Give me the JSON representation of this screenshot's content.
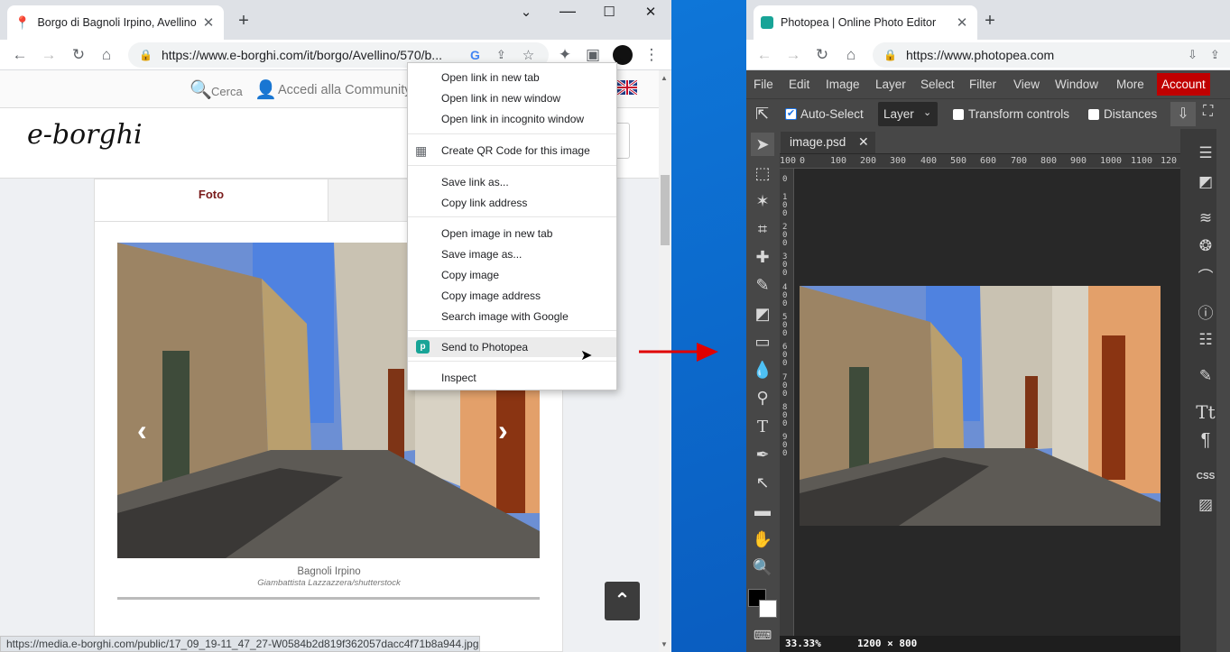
{
  "left_browser": {
    "tab_title": "Borgo di Bagnoli Irpino, Avellino",
    "url": "https://www.e-borghi.com/it/borgo/Avellino/570/b...",
    "window_controls": {
      "minimize": "—",
      "maximize": "☐",
      "close": "✕",
      "dropdown": "⌄"
    },
    "site": {
      "search_label": "Cerca",
      "community_label": "Accedi alla Community",
      "logo": "e-borghi",
      "tab_foto": "Foto",
      "caption_title": "Bagnoli Irpino",
      "caption_credit": "Giambattista Lazzazzera/shutterstock"
    },
    "status_url": "https://media.e-borghi.com/public/17_09_19-11_47_27-W0584b2d819f362057dacc4f71b8a944.jpg"
  },
  "context_menu": {
    "items": [
      "Open link in new tab",
      "Open link in new window",
      "Open link in incognito window",
      "Create QR Code for this image",
      "Save link as...",
      "Copy link address",
      "Open image in new tab",
      "Save image as...",
      "Copy image",
      "Copy image address",
      "Search image with Google",
      "Send to Photopea",
      "Inspect"
    ]
  },
  "right_browser": {
    "tab_title": "Photopea | Online Photo Editor",
    "url": "https://www.photopea.com",
    "menu": [
      "File",
      "Edit",
      "Image",
      "Layer",
      "Select",
      "Filter",
      "View",
      "Window",
      "More"
    ],
    "account_label": "Account",
    "options": {
      "auto_select": "Auto-Select",
      "layer_select": "Layer",
      "transform_controls": "Transform controls",
      "distances": "Distances"
    },
    "doc_tab": "image.psd",
    "ruler_ticks": [
      "100",
      "0",
      "100",
      "200",
      "300",
      "400",
      "500",
      "600",
      "700",
      "800",
      "900",
      "1000",
      "1100",
      "120"
    ],
    "vruler_labels": [
      "0",
      "1 0 0",
      "2 0 0",
      "3 0 0",
      "4 0 0",
      "5 0 0",
      "6 0 0",
      "7 0 0",
      "8 0 0",
      "9 0 0"
    ],
    "zoom": "33.33%",
    "doc_size": "1200 × 800",
    "css_label": "CSS"
  },
  "colors": {
    "accent_red": "#e00000",
    "account_bg": "#c00000",
    "photopea_green": "#18a497"
  }
}
